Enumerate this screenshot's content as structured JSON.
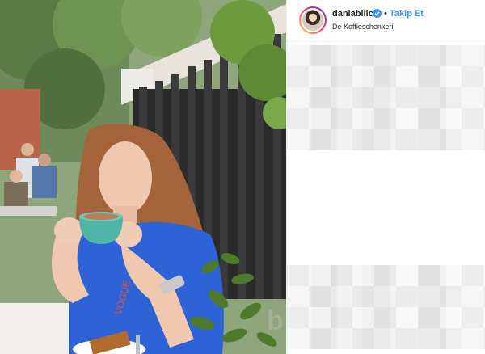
{
  "post": {
    "username": "danlabilic",
    "separator": "•",
    "follow_label": "Takip Et",
    "location": "De Koffieschenkerij",
    "verified": true
  },
  "colors": {
    "follow_blue": "#3897f0",
    "verified_blue": "#3897f0",
    "shirt_blue": "#2d63d6",
    "cup_teal": "#4fb5a6"
  },
  "icons": {
    "verified": "verified-badge-icon",
    "avatar": "profile-avatar"
  }
}
